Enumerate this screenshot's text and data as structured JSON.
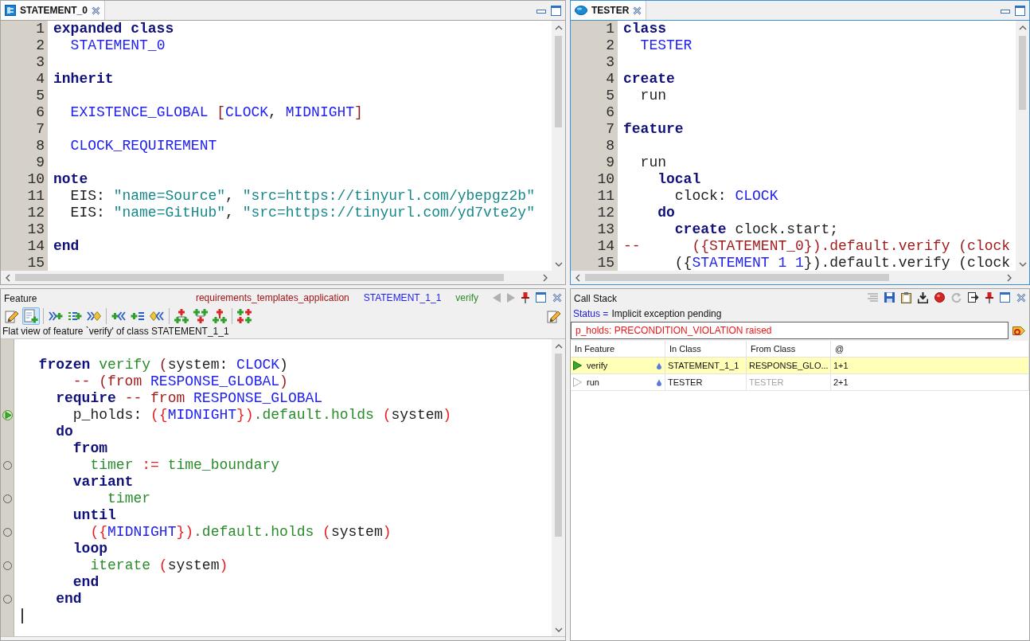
{
  "editors": [
    {
      "tab": {
        "label": "STATEMENT_0",
        "kind": "expanded_class"
      },
      "active": false,
      "lines": [
        {
          "number": "1",
          "tokens": [
            {
              "text": "expanded class",
              "kind": "keyword"
            }
          ]
        },
        {
          "number": "2",
          "tokens": [
            {
              "text": "  STATEMENT_0",
              "kind": "class"
            }
          ]
        },
        {
          "number": "3"
        },
        {
          "number": "4",
          "tokens": [
            {
              "text": "inherit",
              "kind": "keyword"
            }
          ]
        },
        {
          "number": "5"
        },
        {
          "number": "6",
          "tokens": [
            {
              "text": "  EXISTENCE_GLOBAL",
              "kind": "class"
            },
            {
              "text": " [",
              "kind": "bracket"
            },
            {
              "text": "CLOCK",
              "kind": "class"
            },
            {
              "text": ", ",
              "kind": "plain"
            },
            {
              "text": "MIDNIGHT",
              "kind": "class"
            },
            {
              "text": "]",
              "kind": "bracket"
            }
          ]
        },
        {
          "number": "7"
        },
        {
          "number": "8",
          "tokens": [
            {
              "text": "  CLOCK_REQUIREMENT",
              "kind": "class"
            }
          ]
        },
        {
          "number": "9"
        },
        {
          "number": "10",
          "tokens": [
            {
              "text": "note",
              "kind": "keyword"
            }
          ]
        },
        {
          "number": "11",
          "tokens": [
            {
              "text": "  EIS: ",
              "kind": "plain"
            },
            {
              "text": "\"name=Source\"",
              "kind": "string"
            },
            {
              "text": ", ",
              "kind": "plain"
            },
            {
              "text": "\"src=https://tinyurl.com/ybepgz2b\"",
              "kind": "string"
            }
          ]
        },
        {
          "number": "12",
          "tokens": [
            {
              "text": "  EIS: ",
              "kind": "plain"
            },
            {
              "text": "\"name=GitHub\"",
              "kind": "string"
            },
            {
              "text": ", ",
              "kind": "plain"
            },
            {
              "text": "\"src=https://tinyurl.com/yd7vte2y\"",
              "kind": "string"
            }
          ]
        },
        {
          "number": "13"
        },
        {
          "number": "14",
          "tokens": [
            {
              "text": "end",
              "kind": "keyword"
            }
          ]
        },
        {
          "number": "15"
        }
      ]
    },
    {
      "tab": {
        "label": "TESTER",
        "kind": "class"
      },
      "active": true,
      "lines": [
        {
          "number": "1",
          "tokens": [
            {
              "text": "class",
              "kind": "keyword"
            }
          ]
        },
        {
          "number": "2",
          "tokens": [
            {
              "text": "  TESTER",
              "kind": "class"
            }
          ]
        },
        {
          "number": "3"
        },
        {
          "number": "4",
          "tokens": [
            {
              "text": "create",
              "kind": "keyword"
            }
          ]
        },
        {
          "number": "5",
          "tokens": [
            {
              "text": "  run",
              "kind": "plain"
            }
          ]
        },
        {
          "number": "6"
        },
        {
          "number": "7",
          "tokens": [
            {
              "text": "feature",
              "kind": "keyword"
            }
          ]
        },
        {
          "number": "8"
        },
        {
          "number": "9",
          "tokens": [
            {
              "text": "  run",
              "kind": "plain"
            }
          ]
        },
        {
          "number": "10",
          "tokens": [
            {
              "text": "    local",
              "kind": "keyword"
            }
          ]
        },
        {
          "number": "11",
          "tokens": [
            {
              "text": "      clock: ",
              "kind": "plain"
            },
            {
              "text": "CLOCK",
              "kind": "class"
            }
          ]
        },
        {
          "number": "12",
          "tokens": [
            {
              "text": "    do",
              "kind": "keyword"
            }
          ]
        },
        {
          "number": "13",
          "tokens": [
            {
              "text": "      create",
              "kind": "keyword"
            },
            {
              "text": " clock.start;",
              "kind": "plain"
            }
          ]
        },
        {
          "number": "14",
          "tokens": [
            {
              "text": "--      ({STATEMENT_0}).default.verify (clock",
              "kind": "comment"
            }
          ]
        },
        {
          "number": "15",
          "tokens": [
            {
              "text": "      ({",
              "kind": "plain"
            },
            {
              "text": "STATEMENT 1 1",
              "kind": "class"
            },
            {
              "text": "}).default.verify (clock",
              "kind": "plain"
            }
          ]
        }
      ]
    }
  ],
  "feature_view": {
    "title": "Feature",
    "context": [
      {
        "text": "requirements_templates_application",
        "kind": "cluster"
      },
      {
        "text": "STATEMENT_1_1",
        "kind": "class"
      },
      {
        "text": "verify",
        "kind": "feature"
      }
    ],
    "history": [
      {
        "kind": "back",
        "disabled": true
      },
      {
        "kind": "forward",
        "disabled": true
      }
    ],
    "toolbar": {
      "groups": [
        {
          "buttons": [
            {
              "kind": "edit",
              "selected": false
            },
            {
              "kind": "flat",
              "selected": true
            }
          ]
        },
        {
          "buttons": [
            {
              "kind": "arrows_plus",
              "selected": false
            },
            {
              "kind": "lines_plus",
              "selected": false
            },
            {
              "kind": "arrows_gem",
              "selected": false
            }
          ]
        },
        {
          "buttons": [
            {
              "kind": "plus_arrows",
              "selected": false
            },
            {
              "kind": "plus_lines",
              "selected": false
            },
            {
              "kind": "gem_arrows",
              "selected": false
            }
          ]
        },
        {
          "buttons": [
            {
              "kind": "tree_down",
              "selected": false
            },
            {
              "kind": "tree_up",
              "selected": false
            },
            {
              "kind": "tree_stack",
              "selected": false
            }
          ]
        },
        {
          "buttons": [
            {
              "kind": "plus_grid",
              "selected": false
            }
          ]
        }
      ],
      "trailing": {
        "kind": "edit",
        "selected": false
      }
    },
    "description": "Flat view of feature `verify' of class STATEMENT_1_1",
    "lines": [
      {
        "stopped": false,
        "breakpoint": false,
        "caret": false,
        "tokens": [
          {
            "text": "  frozen",
            "kind": "keyword"
          },
          {
            "text": " verify",
            "kind": "feature"
          },
          {
            "text": " (",
            "kind": "bracket"
          },
          {
            "text": "system: ",
            "kind": "plain"
          },
          {
            "text": "CLOCK",
            "kind": "class"
          },
          {
            "text": ")",
            "kind": "plain"
          }
        ]
      },
      {
        "stopped": false,
        "breakpoint": false,
        "caret": false,
        "tokens": [
          {
            "text": "      -- (from ",
            "kind": "comment"
          },
          {
            "text": "RESPONSE_GLOBAL",
            "kind": "class"
          },
          {
            "text": ")",
            "kind": "comment"
          }
        ]
      },
      {
        "stopped": false,
        "breakpoint": false,
        "caret": false,
        "tokens": [
          {
            "text": "    require",
            "kind": "keyword"
          },
          {
            "text": " -- from ",
            "kind": "comment"
          },
          {
            "text": "RESPONSE_GLOBAL",
            "kind": "class"
          }
        ]
      },
      {
        "stopped": true,
        "breakpoint": false,
        "caret": false,
        "tokens": [
          {
            "text": "      p_holds: ",
            "kind": "plain"
          },
          {
            "text": "({",
            "kind": "symbol"
          },
          {
            "text": "MIDNIGHT",
            "kind": "class"
          },
          {
            "text": "})",
            "kind": "symbol"
          },
          {
            "text": ".default.holds",
            "kind": "feature"
          },
          {
            "text": " (",
            "kind": "symbol"
          },
          {
            "text": "system",
            "kind": "plain"
          },
          {
            "text": ")",
            "kind": "symbol"
          }
        ]
      },
      {
        "stopped": false,
        "breakpoint": false,
        "caret": false,
        "tokens": [
          {
            "text": "    do",
            "kind": "keyword"
          }
        ]
      },
      {
        "stopped": false,
        "breakpoint": false,
        "caret": false,
        "tokens": [
          {
            "text": "      from",
            "kind": "keyword"
          }
        ]
      },
      {
        "stopped": false,
        "breakpoint": true,
        "caret": false,
        "tokens": [
          {
            "text": "        timer",
            "kind": "feature"
          },
          {
            "text": " := ",
            "kind": "symbol"
          },
          {
            "text": "time_boundary",
            "kind": "feature"
          }
        ]
      },
      {
        "stopped": false,
        "breakpoint": false,
        "caret": false,
        "tokens": [
          {
            "text": "      variant",
            "kind": "keyword"
          }
        ]
      },
      {
        "stopped": false,
        "breakpoint": true,
        "caret": false,
        "tokens": [
          {
            "text": "          timer",
            "kind": "feature"
          }
        ]
      },
      {
        "stopped": false,
        "breakpoint": false,
        "caret": false,
        "tokens": [
          {
            "text": "      until",
            "kind": "keyword"
          }
        ]
      },
      {
        "stopped": false,
        "breakpoint": true,
        "caret": false,
        "tokens": [
          {
            "text": "        ({",
            "kind": "symbol"
          },
          {
            "text": "MIDNIGHT",
            "kind": "class"
          },
          {
            "text": "})",
            "kind": "symbol"
          },
          {
            "text": ".default.holds",
            "kind": "feature"
          },
          {
            "text": " (",
            "kind": "symbol"
          },
          {
            "text": "system",
            "kind": "plain"
          },
          {
            "text": ")",
            "kind": "symbol"
          }
        ]
      },
      {
        "stopped": false,
        "breakpoint": false,
        "caret": false,
        "tokens": [
          {
            "text": "      loop",
            "kind": "keyword"
          }
        ]
      },
      {
        "stopped": false,
        "breakpoint": true,
        "caret": false,
        "tokens": [
          {
            "text": "        iterate",
            "kind": "feature"
          },
          {
            "text": " (",
            "kind": "symbol"
          },
          {
            "text": "system",
            "kind": "plain"
          },
          {
            "text": ")",
            "kind": "symbol"
          }
        ]
      },
      {
        "stopped": false,
        "breakpoint": false,
        "caret": false,
        "tokens": [
          {
            "text": "      end",
            "kind": "keyword"
          }
        ]
      },
      {
        "stopped": false,
        "breakpoint": true,
        "caret": false,
        "tokens": [
          {
            "text": "    end",
            "kind": "keyword"
          }
        ]
      },
      {
        "stopped": false,
        "breakpoint": false,
        "caret": true
      }
    ]
  },
  "call_stack": {
    "title": "Call Stack",
    "status": {
      "label": "Status =",
      "value": "Implicit exception pending"
    },
    "exception": "p_holds: PRECONDITION_VIOLATION raised",
    "columns": [
      "In Feature",
      "In Class",
      "From Class",
      "@"
    ],
    "rows": [
      {
        "feature": "verify",
        "in_class": "STATEMENT_1_1",
        "from_class": "RESPONSE_GLO...",
        "position": "1+1",
        "selected": true,
        "from_class_dimmed": false
      },
      {
        "feature": "run",
        "in_class": "TESTER",
        "from_class": "TESTER",
        "position": "2+1",
        "selected": false,
        "from_class_dimmed": true
      }
    ]
  }
}
